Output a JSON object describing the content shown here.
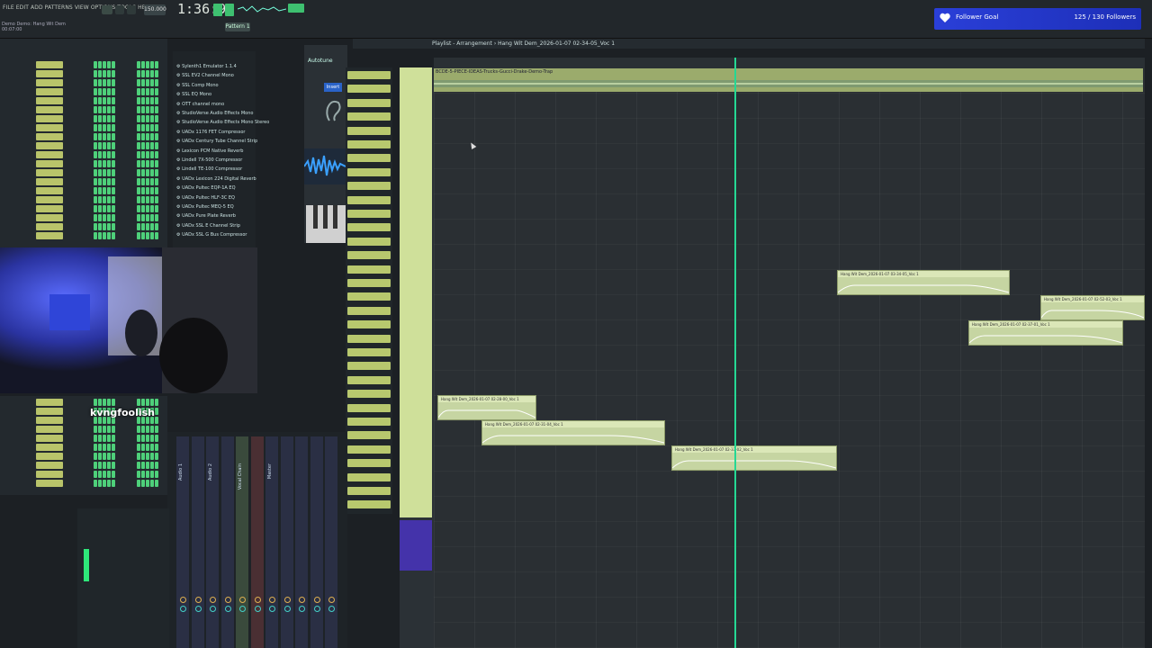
{
  "menu": {
    "text": "FILE EDIT ADD PATTERNS VIEW OPTIONS TOOLS HELP"
  },
  "transport": {
    "tempo": "150.000",
    "time": "1:36:99",
    "pattern_label": "Pattern 1"
  },
  "song": {
    "line1": "Demo Demo: Hang Wit Dem",
    "line2": "00:07:00"
  },
  "alert": {
    "label": "Follower Goal",
    "count": "125 / 130 Followers"
  },
  "streamer": {
    "username": "kvngfoolish"
  },
  "playlist": {
    "title": "Playlist - Arrangement › Hang Wit Dem_2026-01-07 02-34-05_Voc 1",
    "top_clip_label": "BCDE-5-PIECE-IDEAS-Trucks-Gucci-Drake-Demo-Trap",
    "clips": [
      {
        "label": "Hang Wit Dem_2026-01-07 03-34-05_Voc 1"
      },
      {
        "label": "Hang Wit Dem_2026-01-07 02-52-03_Voc 1"
      },
      {
        "label": "Hang Wit Dem_2026-01-07 02-37-01_Voc 1"
      },
      {
        "label": "Hang Wit Dem_2026-01-07 02-28-00_Voc 1"
      },
      {
        "label": "Hang Wit Dem_2026-01-07 02-31-04_Voc 1"
      },
      {
        "label": "Hang Wit Dem_2026-01-07 02-33-02_Voc 1"
      }
    ]
  },
  "browser": {
    "items": [
      "Sylenth1 Emulator 1.1.4",
      "SSL EV2 Channel Mono",
      "SSL Comp Mono",
      "SSL EQ Mono",
      "OTT channel mono",
      "StudioVerse Audio Effects Mono",
      "StudioVerse Audio Effects Mono Stereo",
      "UADx 1176 FET Compressor",
      "UADx Century Tube Channel Strip",
      "Lexicon PCM Native Reverb",
      "Lindell 7X-500 Compressor",
      "Lindell TE-100 Compressor",
      "UADx Lexicon 224 Digital Reverb",
      "UADx Pultec EQP-1A EQ",
      "UADx Pultec HLF-3C EQ",
      "UADx Pultec MEQ-5 EQ",
      "UADx Pure Plate Reverb",
      "UADx SSL E Channel Strip",
      "UADx SSL G Bus Compressor"
    ]
  },
  "picker": {
    "title": "Autotune",
    "blue_label": "Insert"
  },
  "mixer": {
    "labels": [
      "Audio 1",
      "Audio 2",
      "Vocal Chain",
      "Master"
    ]
  },
  "colors": {
    "accent": "#25d894",
    "clip": "#c6d5a2",
    "step": "#4ed07a",
    "alert": "#2a3fd8"
  }
}
